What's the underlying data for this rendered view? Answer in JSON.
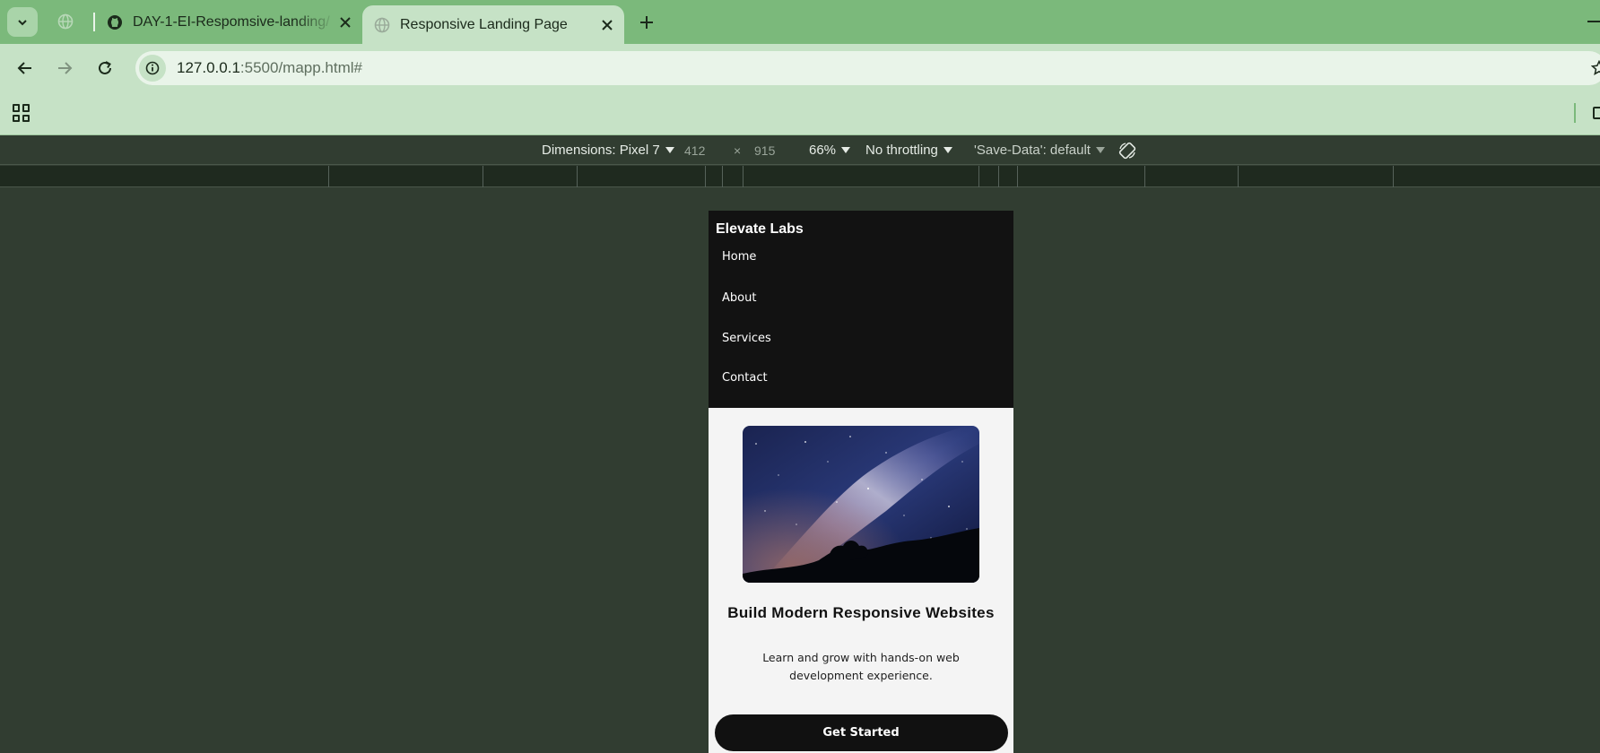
{
  "browser": {
    "tabs": [
      {
        "title": "DAY-1-EI-Respomsive-landing/",
        "active": false
      },
      {
        "title": "Responsive Landing Page",
        "active": true
      }
    ],
    "url_host": "127.0.0.1",
    "url_rest": ":5500/mapp.html#"
  },
  "devtools": {
    "dimensions_label": "Dimensions: Pixel 7",
    "width": "412",
    "times": "×",
    "height": "915",
    "zoom": "66%",
    "throttling": "No throttling",
    "save_data": "'Save-Data': default"
  },
  "page": {
    "brand": "Elevate Labs",
    "nav": [
      "Home",
      "About",
      "Services",
      "Contact"
    ],
    "hero_title": "Build Modern Responsive Websites",
    "hero_text": "Learn and grow with hands-on web development experience.",
    "cta_label": "Get Started"
  },
  "colors": {
    "tabstrip": "#7bb97b",
    "toolbar": "#c6e2c6",
    "devtools_bg": "#313d31",
    "site_header": "#121212",
    "site_bg": "#f4f4f4"
  }
}
